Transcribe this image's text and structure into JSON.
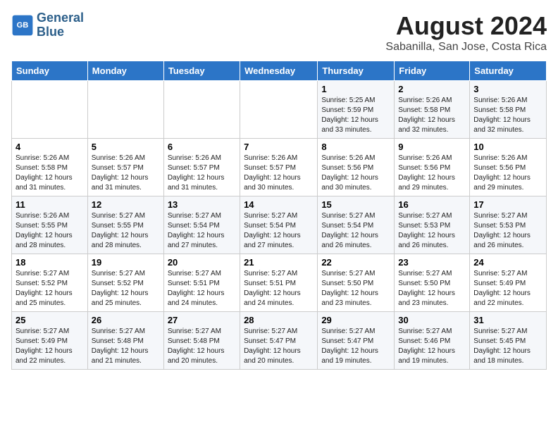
{
  "logo": {
    "line1": "General",
    "line2": "Blue"
  },
  "title": "August 2024",
  "location": "Sabanilla, San Jose, Costa Rica",
  "days_of_week": [
    "Sunday",
    "Monday",
    "Tuesday",
    "Wednesday",
    "Thursday",
    "Friday",
    "Saturday"
  ],
  "weeks": [
    [
      {
        "num": "",
        "info": ""
      },
      {
        "num": "",
        "info": ""
      },
      {
        "num": "",
        "info": ""
      },
      {
        "num": "",
        "info": ""
      },
      {
        "num": "1",
        "info": "Sunrise: 5:25 AM\nSunset: 5:59 PM\nDaylight: 12 hours\nand 33 minutes."
      },
      {
        "num": "2",
        "info": "Sunrise: 5:26 AM\nSunset: 5:58 PM\nDaylight: 12 hours\nand 32 minutes."
      },
      {
        "num": "3",
        "info": "Sunrise: 5:26 AM\nSunset: 5:58 PM\nDaylight: 12 hours\nand 32 minutes."
      }
    ],
    [
      {
        "num": "4",
        "info": "Sunrise: 5:26 AM\nSunset: 5:58 PM\nDaylight: 12 hours\nand 31 minutes."
      },
      {
        "num": "5",
        "info": "Sunrise: 5:26 AM\nSunset: 5:57 PM\nDaylight: 12 hours\nand 31 minutes."
      },
      {
        "num": "6",
        "info": "Sunrise: 5:26 AM\nSunset: 5:57 PM\nDaylight: 12 hours\nand 31 minutes."
      },
      {
        "num": "7",
        "info": "Sunrise: 5:26 AM\nSunset: 5:57 PM\nDaylight: 12 hours\nand 30 minutes."
      },
      {
        "num": "8",
        "info": "Sunrise: 5:26 AM\nSunset: 5:56 PM\nDaylight: 12 hours\nand 30 minutes."
      },
      {
        "num": "9",
        "info": "Sunrise: 5:26 AM\nSunset: 5:56 PM\nDaylight: 12 hours\nand 29 minutes."
      },
      {
        "num": "10",
        "info": "Sunrise: 5:26 AM\nSunset: 5:56 PM\nDaylight: 12 hours\nand 29 minutes."
      }
    ],
    [
      {
        "num": "11",
        "info": "Sunrise: 5:26 AM\nSunset: 5:55 PM\nDaylight: 12 hours\nand 28 minutes."
      },
      {
        "num": "12",
        "info": "Sunrise: 5:27 AM\nSunset: 5:55 PM\nDaylight: 12 hours\nand 28 minutes."
      },
      {
        "num": "13",
        "info": "Sunrise: 5:27 AM\nSunset: 5:54 PM\nDaylight: 12 hours\nand 27 minutes."
      },
      {
        "num": "14",
        "info": "Sunrise: 5:27 AM\nSunset: 5:54 PM\nDaylight: 12 hours\nand 27 minutes."
      },
      {
        "num": "15",
        "info": "Sunrise: 5:27 AM\nSunset: 5:54 PM\nDaylight: 12 hours\nand 26 minutes."
      },
      {
        "num": "16",
        "info": "Sunrise: 5:27 AM\nSunset: 5:53 PM\nDaylight: 12 hours\nand 26 minutes."
      },
      {
        "num": "17",
        "info": "Sunrise: 5:27 AM\nSunset: 5:53 PM\nDaylight: 12 hours\nand 26 minutes."
      }
    ],
    [
      {
        "num": "18",
        "info": "Sunrise: 5:27 AM\nSunset: 5:52 PM\nDaylight: 12 hours\nand 25 minutes."
      },
      {
        "num": "19",
        "info": "Sunrise: 5:27 AM\nSunset: 5:52 PM\nDaylight: 12 hours\nand 25 minutes."
      },
      {
        "num": "20",
        "info": "Sunrise: 5:27 AM\nSunset: 5:51 PM\nDaylight: 12 hours\nand 24 minutes."
      },
      {
        "num": "21",
        "info": "Sunrise: 5:27 AM\nSunset: 5:51 PM\nDaylight: 12 hours\nand 24 minutes."
      },
      {
        "num": "22",
        "info": "Sunrise: 5:27 AM\nSunset: 5:50 PM\nDaylight: 12 hours\nand 23 minutes."
      },
      {
        "num": "23",
        "info": "Sunrise: 5:27 AM\nSunset: 5:50 PM\nDaylight: 12 hours\nand 23 minutes."
      },
      {
        "num": "24",
        "info": "Sunrise: 5:27 AM\nSunset: 5:49 PM\nDaylight: 12 hours\nand 22 minutes."
      }
    ],
    [
      {
        "num": "25",
        "info": "Sunrise: 5:27 AM\nSunset: 5:49 PM\nDaylight: 12 hours\nand 22 minutes."
      },
      {
        "num": "26",
        "info": "Sunrise: 5:27 AM\nSunset: 5:48 PM\nDaylight: 12 hours\nand 21 minutes."
      },
      {
        "num": "27",
        "info": "Sunrise: 5:27 AM\nSunset: 5:48 PM\nDaylight: 12 hours\nand 20 minutes."
      },
      {
        "num": "28",
        "info": "Sunrise: 5:27 AM\nSunset: 5:47 PM\nDaylight: 12 hours\nand 20 minutes."
      },
      {
        "num": "29",
        "info": "Sunrise: 5:27 AM\nSunset: 5:47 PM\nDaylight: 12 hours\nand 19 minutes."
      },
      {
        "num": "30",
        "info": "Sunrise: 5:27 AM\nSunset: 5:46 PM\nDaylight: 12 hours\nand 19 minutes."
      },
      {
        "num": "31",
        "info": "Sunrise: 5:27 AM\nSunset: 5:45 PM\nDaylight: 12 hours\nand 18 minutes."
      }
    ]
  ]
}
